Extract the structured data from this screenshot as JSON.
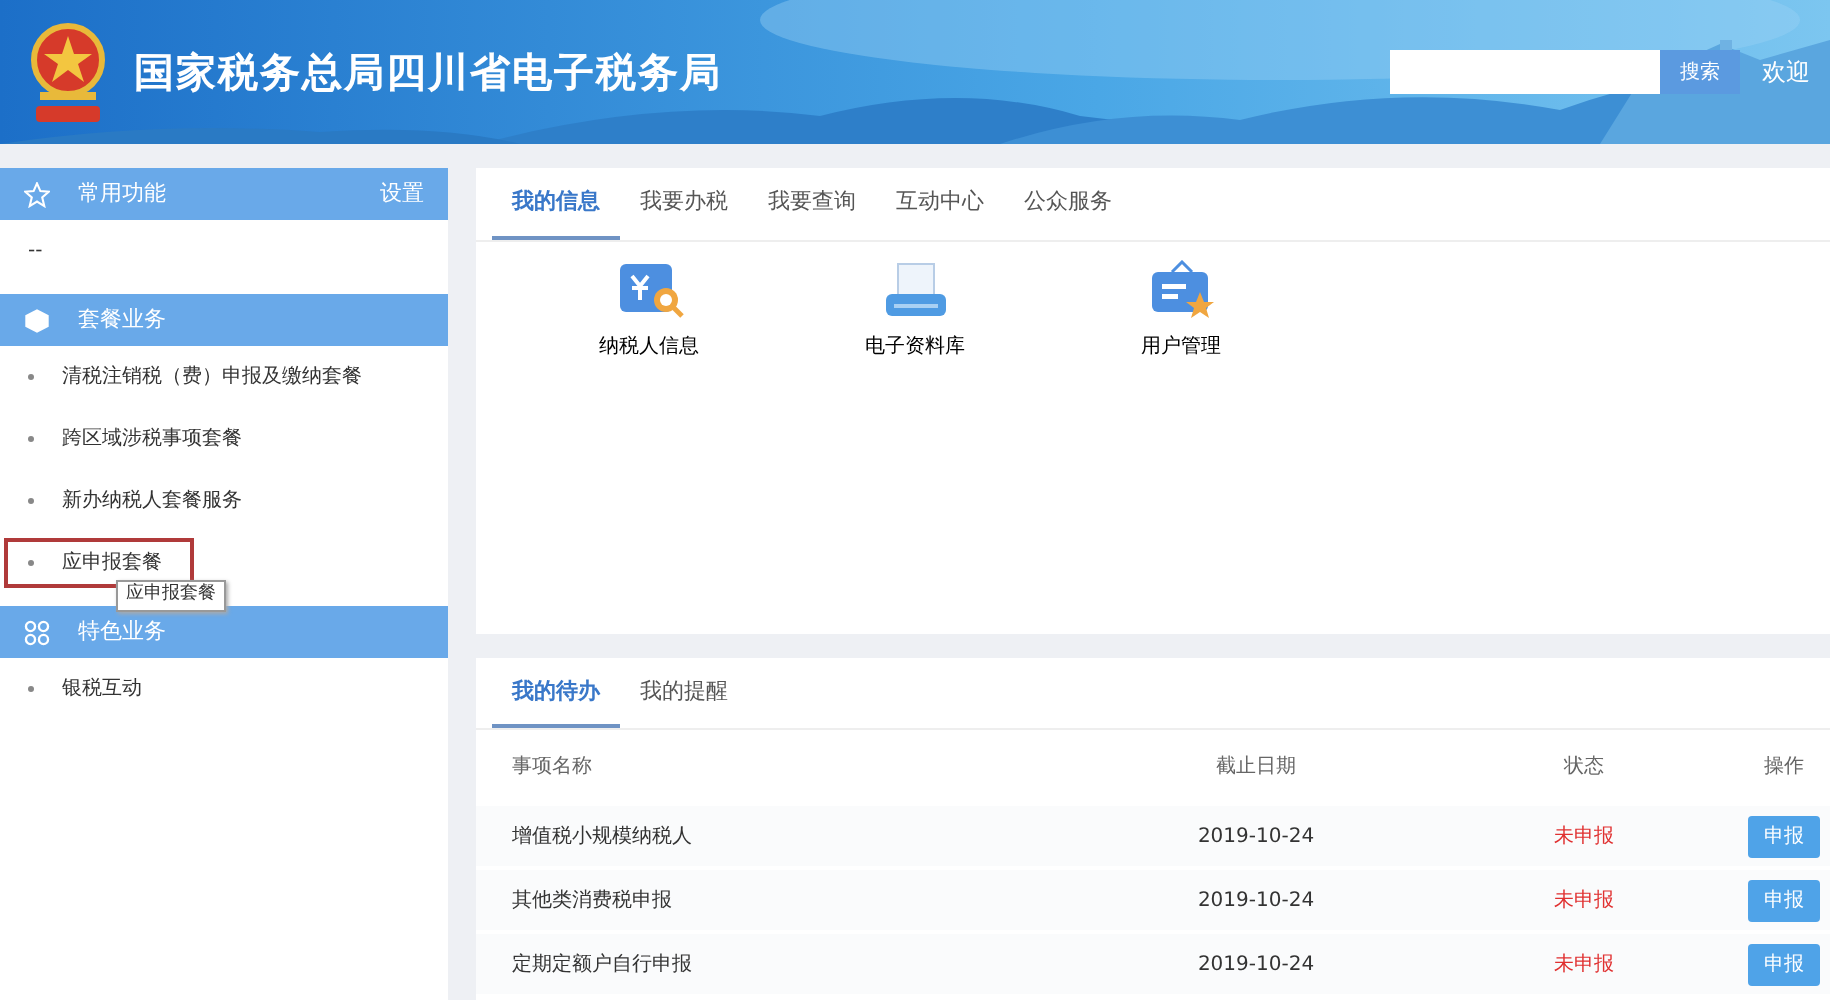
{
  "header": {
    "title": "国家税务总局四川省电子税务局",
    "search": {
      "button": "搜索"
    },
    "welcome": "欢迎"
  },
  "sidebar": {
    "sections": [
      {
        "title": "常用功能",
        "kind": "star",
        "action": "设置",
        "items": [
          {
            "label": "--",
            "kind": "plain",
            "highlighted": false
          }
        ]
      },
      {
        "title": "套餐业务",
        "kind": "box",
        "items": [
          {
            "label": "清税注销税（费）申报及缴纳套餐",
            "kind": "bullet",
            "highlighted": false
          },
          {
            "label": "跨区域涉税事项套餐",
            "kind": "bullet",
            "highlighted": false
          },
          {
            "label": "新办纳税人套餐服务",
            "kind": "bullet",
            "highlighted": false
          },
          {
            "label": "应申报套餐",
            "kind": "bullet",
            "highlighted": true,
            "tooltip": "应申报套餐"
          }
        ]
      },
      {
        "title": "特色业务",
        "kind": "grid",
        "items": [
          {
            "label": "银税互动",
            "kind": "bullet",
            "highlighted": false
          }
        ]
      }
    ]
  },
  "info_panel": {
    "tabs": [
      {
        "label": "我的信息",
        "selected": true
      },
      {
        "label": "我要办税",
        "selected": false
      },
      {
        "label": "我要查询",
        "selected": false
      },
      {
        "label": "互动中心",
        "selected": false
      },
      {
        "label": "公众服务",
        "selected": false
      }
    ],
    "shortcuts": [
      {
        "label": "纳税人信息",
        "kind": "taxpayer"
      },
      {
        "label": "电子资料库",
        "kind": "library"
      },
      {
        "label": "用户管理",
        "kind": "user"
      }
    ]
  },
  "todo_panel": {
    "tabs": [
      {
        "label": "我的待办",
        "selected": true
      },
      {
        "label": "我的提醒",
        "selected": false
      }
    ],
    "table": {
      "columns": [
        "事项名称",
        "截止日期",
        "状态",
        "操作"
      ],
      "rows": [
        {
          "name": "增值税小规模纳税人",
          "date": "2019-10-24",
          "status": "未申报",
          "action": "申报"
        },
        {
          "name": "其他类消费税申报",
          "date": "2019-10-24",
          "status": "未申报",
          "action": "申报"
        },
        {
          "name": "定期定额户自行申报",
          "date": "2019-10-24",
          "status": "未申报",
          "action": "申报"
        }
      ]
    }
  }
}
